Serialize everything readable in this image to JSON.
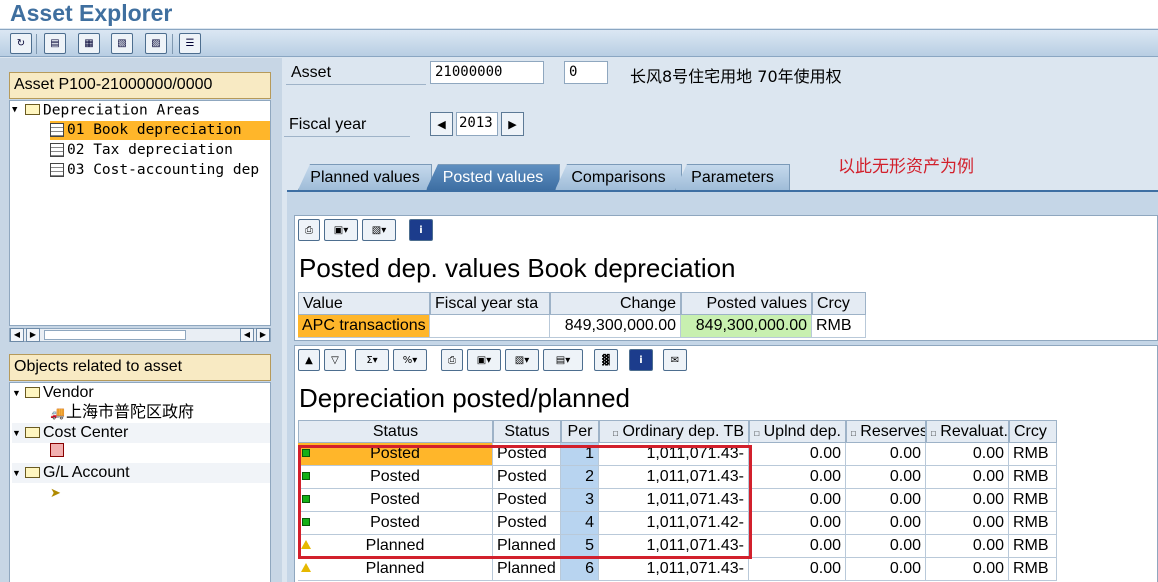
{
  "app": {
    "title": "Asset Explorer"
  },
  "toolbar": {
    "icons": [
      "refresh-icon",
      "display-change-icon",
      "asset-icon",
      "depreciation-icon",
      "simulation-icon",
      "overview-icon"
    ]
  },
  "left": {
    "asset_title": "Asset P100-21000000/0000",
    "tree": [
      {
        "label": "Depreciation Areas",
        "level": 0
      },
      {
        "label": "01 Book depreciation",
        "level": 1,
        "selected": true
      },
      {
        "label": "02 Tax depreciation",
        "level": 1
      },
      {
        "label": "03 Cost-accounting dep",
        "level": 1
      }
    ],
    "objects_title": "Objects related to asset",
    "objects": [
      {
        "label": "Vendor",
        "type": "folder"
      },
      {
        "label": "上海市普陀区政府",
        "type": "vendor"
      },
      {
        "label": "Cost Center",
        "type": "folder"
      },
      {
        "label": "",
        "type": "costcenter"
      },
      {
        "label": "G/L Account",
        "type": "folder"
      },
      {
        "label": "",
        "type": "glaccount"
      }
    ]
  },
  "header": {
    "asset_label": "Asset",
    "asset_number": "21000000",
    "sub_number": "0",
    "asset_desc": "长风8号住宅用地 70年使用权",
    "fiscal_year_label": "Fiscal year",
    "fiscal_year": "2013"
  },
  "tabs": [
    "Planned values",
    "Posted values",
    "Comparisons",
    "Parameters"
  ],
  "active_tab": "Posted values",
  "annotation": "以此无形资产为例",
  "posted_panel": {
    "title": "Posted dep. values Book depreciation",
    "columns": [
      "Value",
      "Fiscal year sta",
      "Change",
      "Posted values",
      "Crcy"
    ],
    "row": {
      "value": "APC transactions",
      "fy_start": "",
      "change": "849,300,000.00",
      "posted": "849,300,000.00",
      "crcy": "RMB"
    }
  },
  "dep_panel": {
    "title": "Depreciation posted/planned",
    "columns": [
      "Status",
      "Status",
      "Per",
      "Ordinary dep. TB",
      "Uplnd dep.",
      "Reserves",
      "Revaluat.",
      "Crcy"
    ],
    "rows": [
      {
        "icon": "green",
        "status1": "Posted",
        "status2": "Posted",
        "per": "1",
        "ord": "1,011,071.43-",
        "unpl": "0.00",
        "res": "0.00",
        "rev": "0.00",
        "crcy": "RMB"
      },
      {
        "icon": "green",
        "status1": "Posted",
        "status2": "Posted",
        "per": "2",
        "ord": "1,011,071.43-",
        "unpl": "0.00",
        "res": "0.00",
        "rev": "0.00",
        "crcy": "RMB"
      },
      {
        "icon": "green",
        "status1": "Posted",
        "status2": "Posted",
        "per": "3",
        "ord": "1,011,071.43-",
        "unpl": "0.00",
        "res": "0.00",
        "rev": "0.00",
        "crcy": "RMB"
      },
      {
        "icon": "green",
        "status1": "Posted",
        "status2": "Posted",
        "per": "4",
        "ord": "1,011,071.42-",
        "unpl": "0.00",
        "res": "0.00",
        "rev": "0.00",
        "crcy": "RMB"
      },
      {
        "icon": "yellow",
        "status1": "Planned",
        "status2": "Planned",
        "per": "5",
        "ord": "1,011,071.43-",
        "unpl": "0.00",
        "res": "0.00",
        "rev": "0.00",
        "crcy": "RMB"
      },
      {
        "icon": "yellow",
        "status1": "Planned",
        "status2": "Planned",
        "per": "6",
        "ord": "1,011,071.43-",
        "unpl": "0.00",
        "res": "0.00",
        "rev": "0.00",
        "crcy": "RMB"
      }
    ]
  },
  "colors": {
    "selection": "#ffb62a",
    "highlight_box": "#d2202c",
    "active_tab": "#3e6fa3",
    "posted_values_bg": "#c8f0b0",
    "per_bg": "#b8d4f0"
  }
}
